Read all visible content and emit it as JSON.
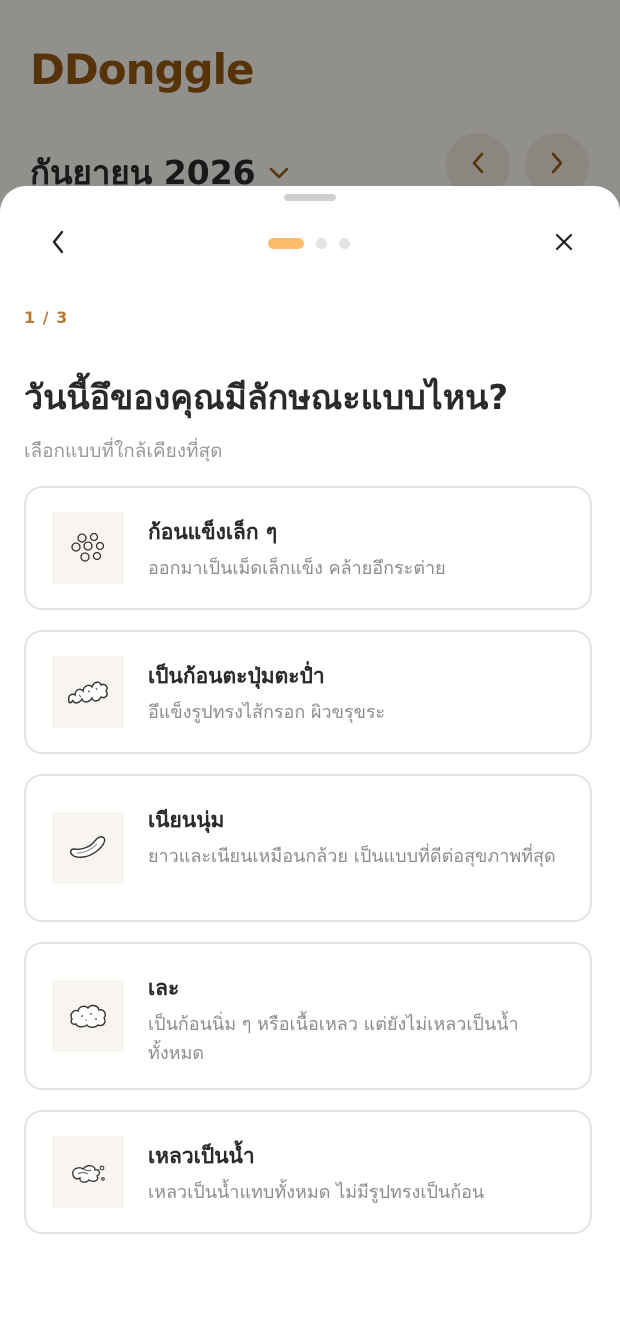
{
  "app": {
    "logo": "DDonggle",
    "month_label": "กันยายน 2026",
    "accent_color": "#9a5a12"
  },
  "sheet": {
    "step_indicator": "1 / 3",
    "question": "วันนี้อึของคุณมีลักษณะแบบไหน?",
    "hint": "เลือกแบบที่ใกล้เคียงที่สุด",
    "progress_dots": {
      "total": 3,
      "active": 1
    },
    "accent_color": "#fdbd6a",
    "options": [
      {
        "title": "ก้อนแข็งเล็ก ๆ",
        "description": "ออกมาเป็นเม็ดเล็กแข็ง คล้ายอึกระต่าย",
        "icon": "pellets-icon"
      },
      {
        "title": "เป็นก้อนตะปุ่มตะป่ำ",
        "description": "อึแข็งรูปทรงไส้กรอก ผิวขรุขระ",
        "icon": "lumpy-sausage-icon"
      },
      {
        "title": "เนียนนุ่ม",
        "description": "ยาวและเนียนเหมือนกล้วย เป็นแบบที่ดีต่อสุขภาพที่สุด",
        "icon": "smooth-banana-icon"
      },
      {
        "title": "เละ",
        "description": "เป็นก้อนนิ่ม ๆ หรือเนื้อเหลว แต่ยังไม่เหลวเป็นน้ำทั้งหมด",
        "icon": "mushy-blob-icon"
      },
      {
        "title": "เหลวเป็นน้ำ",
        "description": "เหลวเป็นน้ำแทบทั้งหมด ไม่มีรูปทรงเป็นก้อน",
        "icon": "watery-splash-icon"
      }
    ]
  }
}
